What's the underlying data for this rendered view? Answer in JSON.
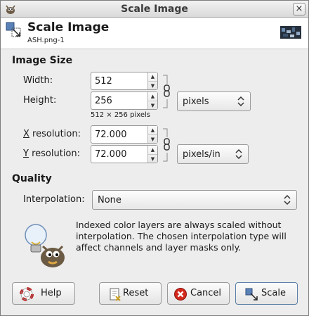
{
  "window": {
    "title": "Scale Image",
    "close_glyph": "×",
    "app_icon": "gimp-wilber-icon"
  },
  "header": {
    "title": "Scale Image",
    "subtitle": "ASH.png-1",
    "icon": "scale-image-icon"
  },
  "image_size": {
    "heading": "Image Size",
    "width_label": "Width:",
    "width_value": "512",
    "height_label": "Height:",
    "height_value": "256",
    "size_unit": "pixels",
    "dimensions_text": "512 × 256 pixels",
    "xres_label": "X resolution:",
    "xres_value": "72.000",
    "yres_label": "Y resolution:",
    "yres_value": "72.000",
    "res_unit": "pixels/in"
  },
  "quality": {
    "heading": "Quality",
    "interp_label": "Interpolation:",
    "interp_value": "None"
  },
  "info": {
    "text": "Indexed color layers are always scaled without interpolation. The chosen interpolation type will affect channels and layer masks only.",
    "icon": "lightbulb-wilber-icon"
  },
  "buttons": {
    "help": "Help",
    "reset": "Reset",
    "cancel": "Cancel",
    "scale": "Scale"
  },
  "spin_arrows": {
    "up": "▲",
    "down": "▼"
  }
}
